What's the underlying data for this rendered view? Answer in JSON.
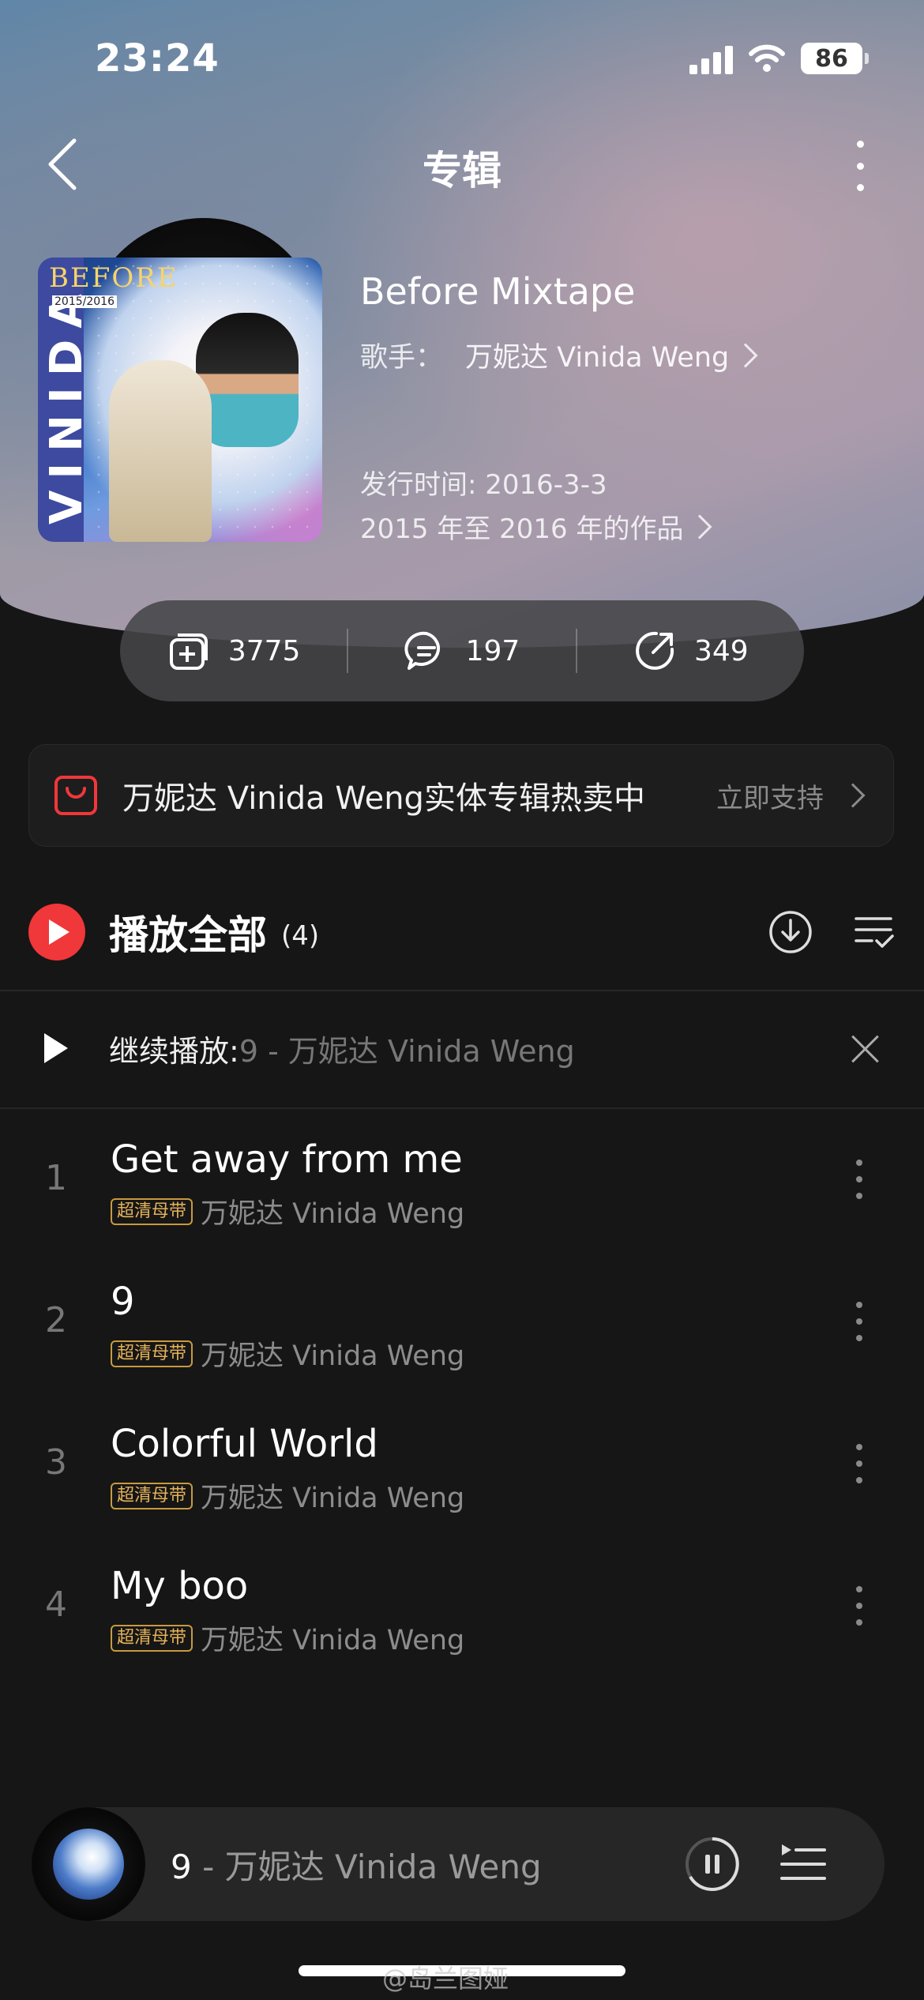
{
  "status": {
    "time": "23:24",
    "battery": "86"
  },
  "nav": {
    "title": "专辑"
  },
  "album": {
    "cover_text": "VINIDA",
    "cover_title": "BEFORE",
    "cover_year": "2015/2016",
    "name": "Before Mixtape",
    "artist_label": "歌手：",
    "artist": "万妮达 Vinida Weng",
    "release": "发行时间: 2016-3-3",
    "period": "2015 年至 2016 年的作品"
  },
  "stats": {
    "collect": "3775",
    "comment": "197",
    "share": "349"
  },
  "promo": {
    "text": "万妮达 Vinida Weng实体专辑热卖中",
    "action": "立即支持"
  },
  "playall": {
    "label": "播放全部",
    "count": "(4)"
  },
  "continue": {
    "label": "继续播放:",
    "track": "9 - 万妮达 Vinida Weng"
  },
  "songs": [
    {
      "no": "1",
      "title": "Get away from me",
      "badge": "超清母带",
      "artist": "万妮达 Vinida Weng"
    },
    {
      "no": "2",
      "title": "9",
      "badge": "超清母带",
      "artist": "万妮达 Vinida Weng"
    },
    {
      "no": "3",
      "title": "Colorful World",
      "badge": "超清母带",
      "artist": "万妮达 Vinida Weng"
    },
    {
      "no": "4",
      "title": "My boo",
      "badge": "超清母带",
      "artist": "万妮达 Vinida Weng"
    }
  ],
  "mini_player": {
    "title": "9",
    "separator": " - ",
    "artist": "万妮达 Vinida Weng"
  },
  "watermark": "@岛兰图娅",
  "colors": {
    "accent": "#f0373a",
    "badge": "#e4b259",
    "background": "#161616"
  },
  "icons": [
    "back-icon",
    "more-icon",
    "collect-icon",
    "comment-icon",
    "share-icon",
    "shop-bag-icon",
    "download-icon",
    "multi-select-icon",
    "close-icon",
    "pause-icon",
    "queue-icon"
  ]
}
